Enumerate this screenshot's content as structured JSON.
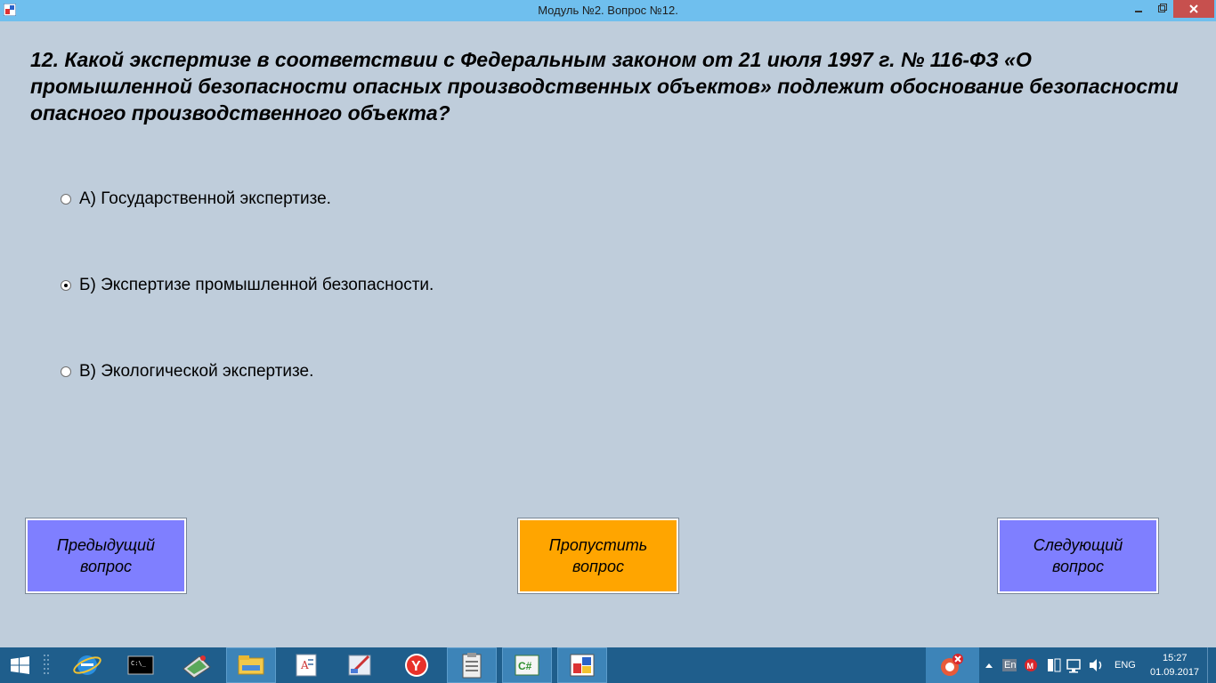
{
  "window": {
    "title": "Модуль №2. Вопрос №12."
  },
  "question": {
    "text": "12. Какой экспертизе в соответствии с Федеральным законом от 21 июля 1997 г. № 116-ФЗ «О промышленной безопасности опасных производственных объектов» подлежит обоснование безопасности опасного производственного объекта?"
  },
  "options": [
    {
      "label": "А) Государственной экспертизе.",
      "selected": false
    },
    {
      "label": "Б) Экспертизе промышленной безопасности.",
      "selected": true
    },
    {
      "label": "В) Экологической экспертизе.",
      "selected": false
    }
  ],
  "buttons": {
    "prev": "Предыдущий\nвопрос",
    "skip": "Пропустить\nвопрос",
    "next": "Следующий\nвопрос"
  },
  "colors": {
    "background": "#bfcddb",
    "nav_button": "#7f7fff",
    "skip_button": "#ffa500",
    "titlebar": "#6fbfee",
    "taskbar": "#1f5e8c"
  },
  "taskbar": {
    "apps": [
      "start-icon",
      "windows-explorer-ie-icon",
      "cmd-icon",
      "scanner-icon",
      "file-explorer-icon",
      "text-editor-icon",
      "paint-icon",
      "yandex-browser-icon",
      "clipboard-icon",
      "csharp-icon",
      "app-window-icon"
    ],
    "lang_short": "En",
    "lang": "ENG",
    "time": "15:27",
    "date": "01.09.2017"
  }
}
